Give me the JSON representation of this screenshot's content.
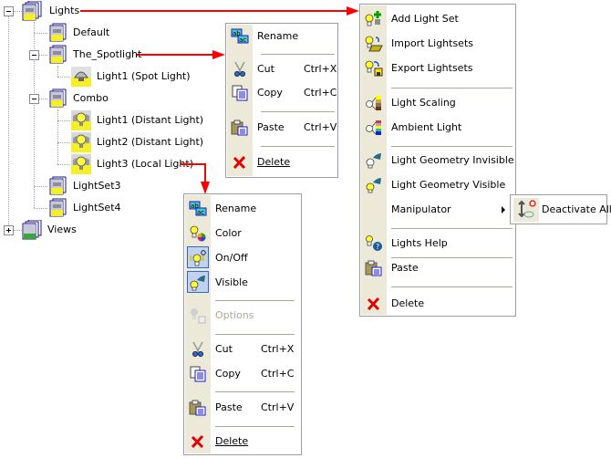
{
  "tree": {
    "nodes": [
      {
        "label": "Lights",
        "level": 0,
        "expanded": true,
        "icon": "light-set-stack-icon"
      },
      {
        "label": "Default",
        "level": 1,
        "icon": "light-set-icon"
      },
      {
        "label": "The_Spotlight",
        "level": 1,
        "expanded": true,
        "icon": "light-set-icon"
      },
      {
        "label": "Light1 (Spot Light)",
        "level": 2,
        "icon": "spot-light-icon"
      },
      {
        "label": "Combo",
        "level": 1,
        "expanded": true,
        "icon": "light-set-icon"
      },
      {
        "label": "Light1 (Distant Light)",
        "level": 2,
        "icon": "bulb-light-icon"
      },
      {
        "label": "Light2 (Distant Light)",
        "level": 2,
        "icon": "bulb-light-icon"
      },
      {
        "label": "Light3 (Local Light)",
        "level": 2,
        "icon": "bulb-light-icon"
      },
      {
        "label": "LightSet3",
        "level": 1,
        "icon": "light-set-icon"
      },
      {
        "label": "LightSet4",
        "level": 1,
        "icon": "light-set-icon"
      },
      {
        "label": "Views",
        "level": 0,
        "expanded": false,
        "icon": "views-stack-icon"
      }
    ]
  },
  "lightset_menu": {
    "items": [
      {
        "label": "Rename",
        "icon": "rename-icon"
      },
      {
        "label": "Cut",
        "shortcut": "Ctrl+X",
        "icon": "scissors-icon"
      },
      {
        "label": "Copy",
        "shortcut": "Ctrl+C",
        "icon": "copy-icon"
      },
      {
        "label": "Paste",
        "shortcut": "Ctrl+V",
        "icon": "paste-icon"
      },
      {
        "label": "Delete",
        "icon": "delete-icon",
        "mnemonic": "D"
      }
    ]
  },
  "lights_menu": {
    "items": [
      {
        "label": "Add Light Set",
        "icon": "add-light-set-icon"
      },
      {
        "label": "Import Lightsets",
        "icon": "import-lightsets-icon"
      },
      {
        "label": "Export Lightsets",
        "icon": "export-lightsets-icon"
      },
      {
        "label": "Light Scaling",
        "icon": "light-scaling-icon"
      },
      {
        "label": "Ambient Light",
        "icon": "ambient-light-icon"
      },
      {
        "label": "Light Geometry Invisible",
        "icon": "geometry-invisible-icon"
      },
      {
        "label": "Light Geometry Visible",
        "icon": "geometry-visible-icon"
      },
      {
        "label": "Manipulator",
        "submenu": true
      },
      {
        "label": "Lights Help",
        "icon": "help-icon"
      },
      {
        "label": "Paste",
        "icon": "paste-icon"
      },
      {
        "label": "Delete",
        "icon": "delete-icon"
      }
    ],
    "submenu": {
      "items": [
        {
          "label": "Deactivate All",
          "icon": "deactivate-all-icon"
        }
      ]
    }
  },
  "light_menu": {
    "items": [
      {
        "label": "Rename",
        "icon": "rename-icon"
      },
      {
        "label": "Color",
        "icon": "color-icon"
      },
      {
        "label": "On/Off",
        "icon": "on-off-icon",
        "checked": true
      },
      {
        "label": "Visible",
        "icon": "visible-icon",
        "checked": true
      },
      {
        "label": "Options",
        "icon": "options-icon",
        "disabled": true
      },
      {
        "label": "Cut",
        "shortcut": "Ctrl+X",
        "icon": "scissors-icon"
      },
      {
        "label": "Copy",
        "shortcut": "Ctrl+C",
        "icon": "copy-icon"
      },
      {
        "label": "Paste",
        "shortcut": "Ctrl+V",
        "icon": "paste-icon"
      },
      {
        "label": "Delete",
        "icon": "delete-icon",
        "mnemonic": "D"
      }
    ]
  },
  "colors": {
    "arrow": "#ff0000",
    "menu_gutter": "#ece9d8",
    "menu_border": "#9d9d9d",
    "separator": "#aca899",
    "disabled_text": "#aca899"
  }
}
